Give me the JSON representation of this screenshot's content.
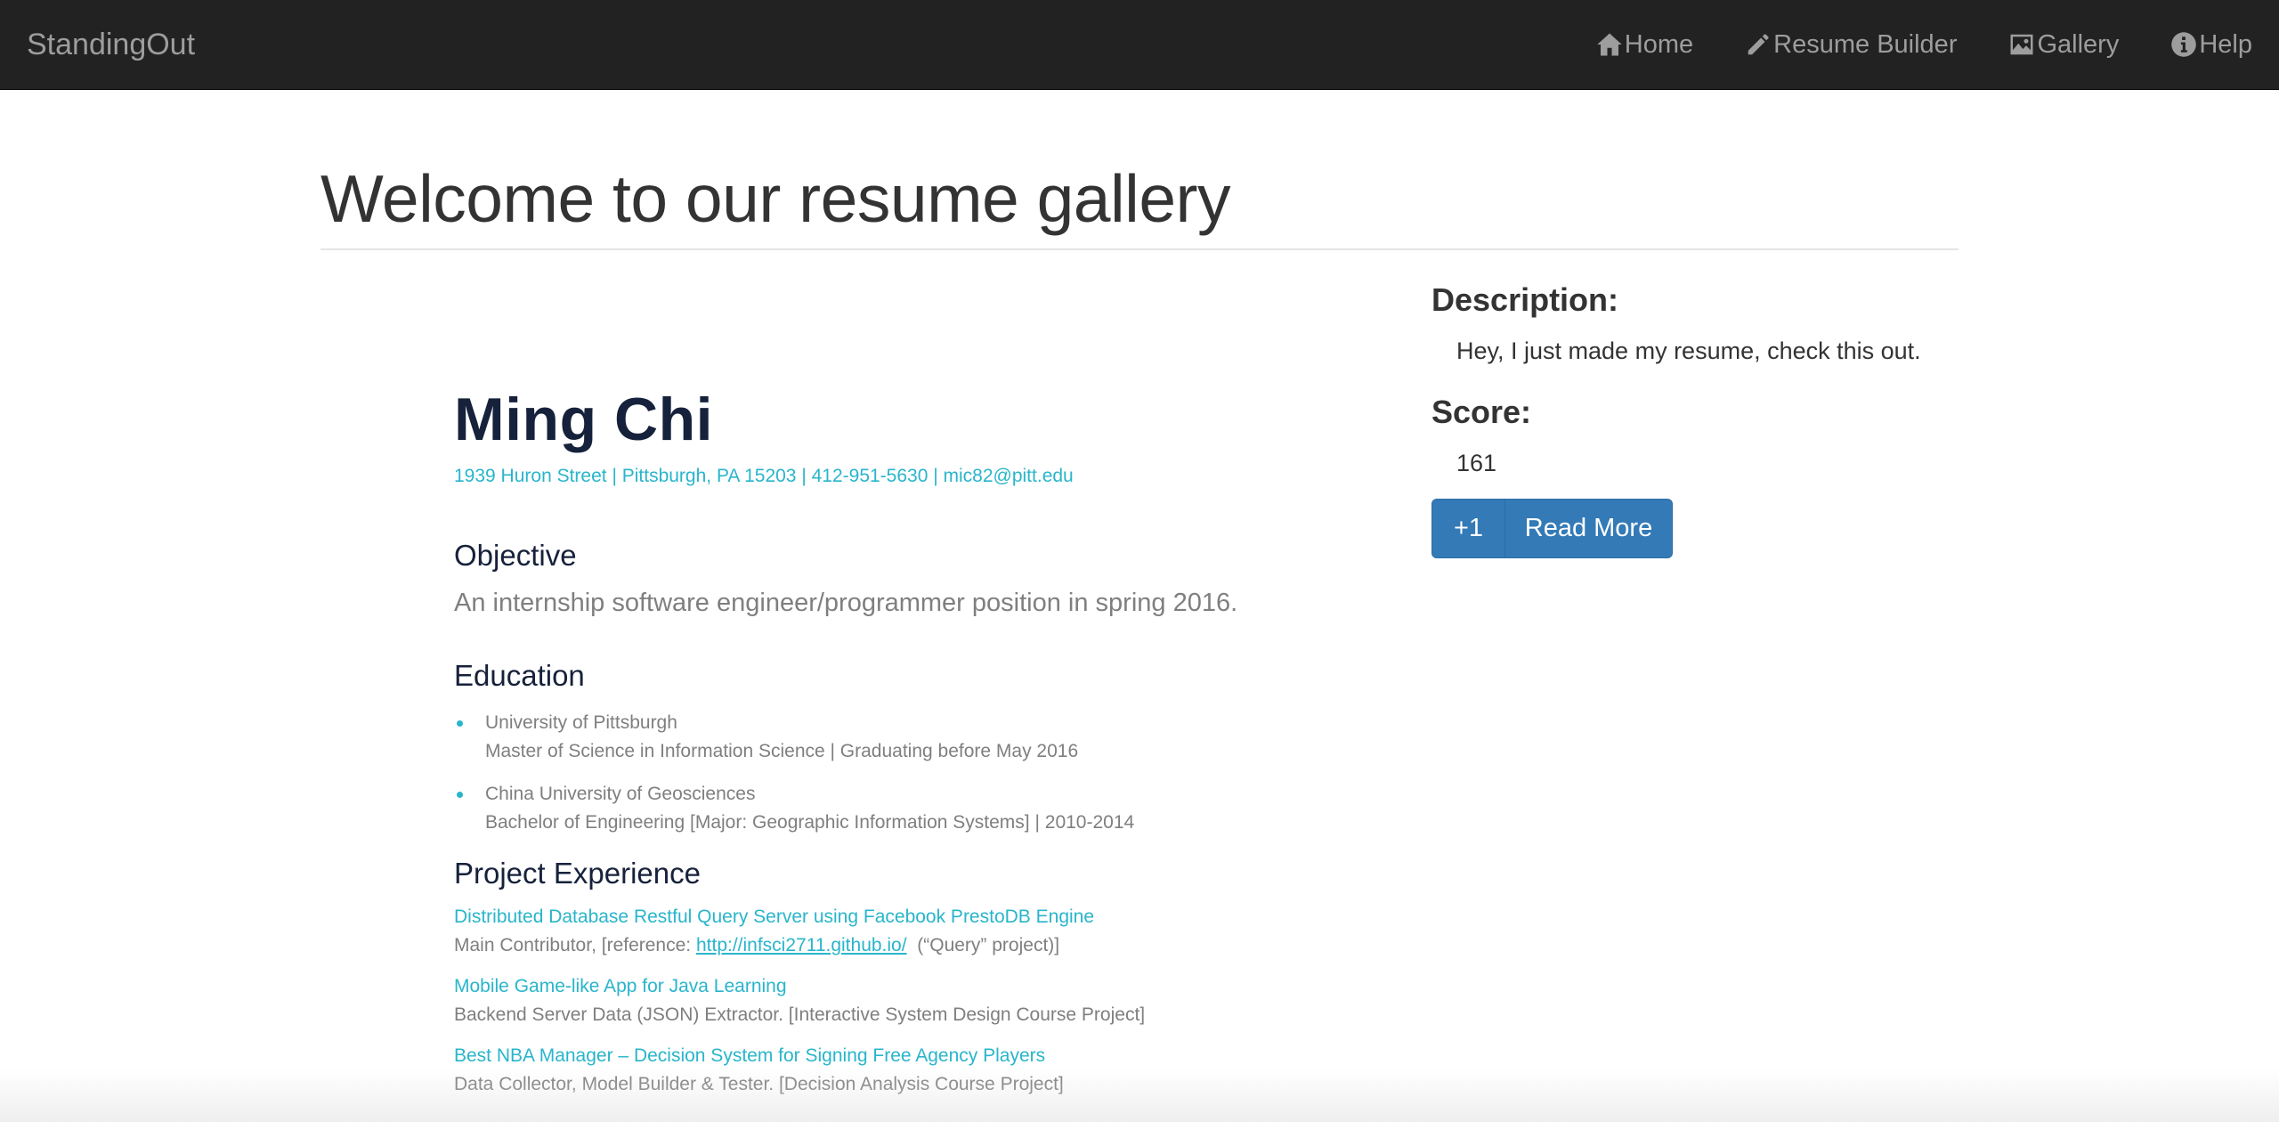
{
  "navbar": {
    "brand": "StandingOut",
    "items": [
      {
        "label": "Home",
        "icon": "home-icon"
      },
      {
        "label": "Resume Builder",
        "icon": "pencil-icon"
      },
      {
        "label": "Gallery",
        "icon": "picture-icon"
      },
      {
        "label": "Help",
        "icon": "info-icon"
      }
    ]
  },
  "page": {
    "title": "Welcome to our resume gallery"
  },
  "resume": {
    "name": "Ming Chi",
    "contact": "1939 Huron Street | Pittsburgh, PA 15203 | 412-951-5630 | mic82@pitt.edu",
    "objective_heading": "Objective",
    "objective": "An internship software engineer/programmer position in spring 2016.",
    "education_heading": "Education",
    "education": [
      {
        "school": "University of Pittsburgh",
        "detail": "Master of Science in Information Science | Graduating before May 2016"
      },
      {
        "school": "China University of Geosciences",
        "detail": "Bachelor of Engineering [Major: Geographic Information Systems] | 2010-2014"
      }
    ],
    "project_heading": "Project Experience",
    "projects": [
      {
        "title": "Distributed Database Restful Query Server using Facebook PrestoDB Engine",
        "desc_pre": "Main Contributor, [reference: ",
        "link": "http://infsci2711.github.io/",
        "desc_post": "  (“Query” project)]"
      },
      {
        "title": "Mobile Game-like App for Java Learning",
        "desc": "Backend Server Data (JSON) Extractor. [Interactive System Design Course Project]"
      },
      {
        "title": "Best NBA Manager – Decision System for Signing Free Agency Players",
        "desc": "Data Collector, Model Builder & Tester. [Decision Analysis Course Project]"
      }
    ]
  },
  "side": {
    "description_heading": "Description:",
    "description": "Hey, I just made my resume, check this out.",
    "score_heading": "Score:",
    "score": "161",
    "plus_label": "+1",
    "read_more_label": "Read More"
  },
  "colors": {
    "navbar_bg": "#222222",
    "nav_text": "#9d9d9d",
    "accent_cyan": "#29b5cb",
    "resume_name": "#16213b",
    "button_primary": "#337ab7"
  }
}
